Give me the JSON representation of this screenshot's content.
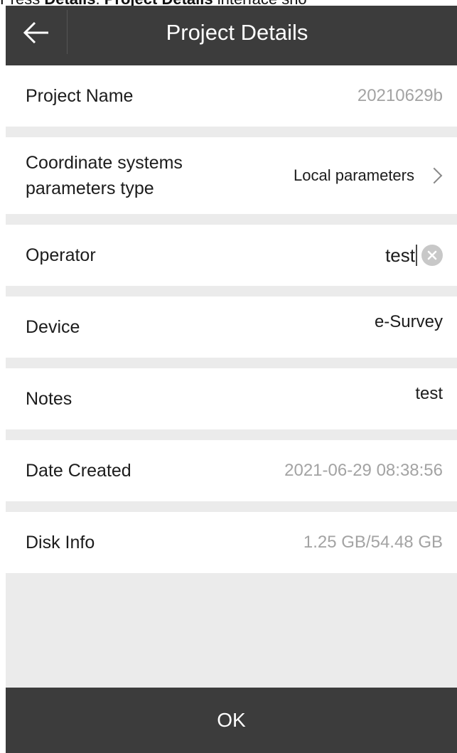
{
  "caption": {
    "prefix": "Press ",
    "bold1": "Details",
    "sep": ". ",
    "bold2": "Project Details",
    "suffix": " interface sho"
  },
  "header": {
    "title": "Project Details",
    "back_icon": "arrow-left-icon"
  },
  "rows": [
    {
      "label": "Project Name",
      "value": "20210629b"
    },
    {
      "label": "Coordinate systems parameters type",
      "value": "Local parameters",
      "icon": "chevron-right-icon"
    },
    {
      "label": "Operator",
      "value": "test",
      "icon": "clear-icon"
    },
    {
      "label": "Device",
      "value": "e-Survey"
    },
    {
      "label": "Notes",
      "value": "test"
    },
    {
      "label": "Date Created",
      "value": "2021-06-29 08:38:56"
    },
    {
      "label": "Disk Info",
      "value": "1.25 GB/54.48 GB"
    }
  ],
  "footer": {
    "ok_label": "OK"
  },
  "colors": {
    "bar": "#3c3c3c",
    "background": "#ebebeb",
    "muted_text": "#a3a3a3"
  }
}
